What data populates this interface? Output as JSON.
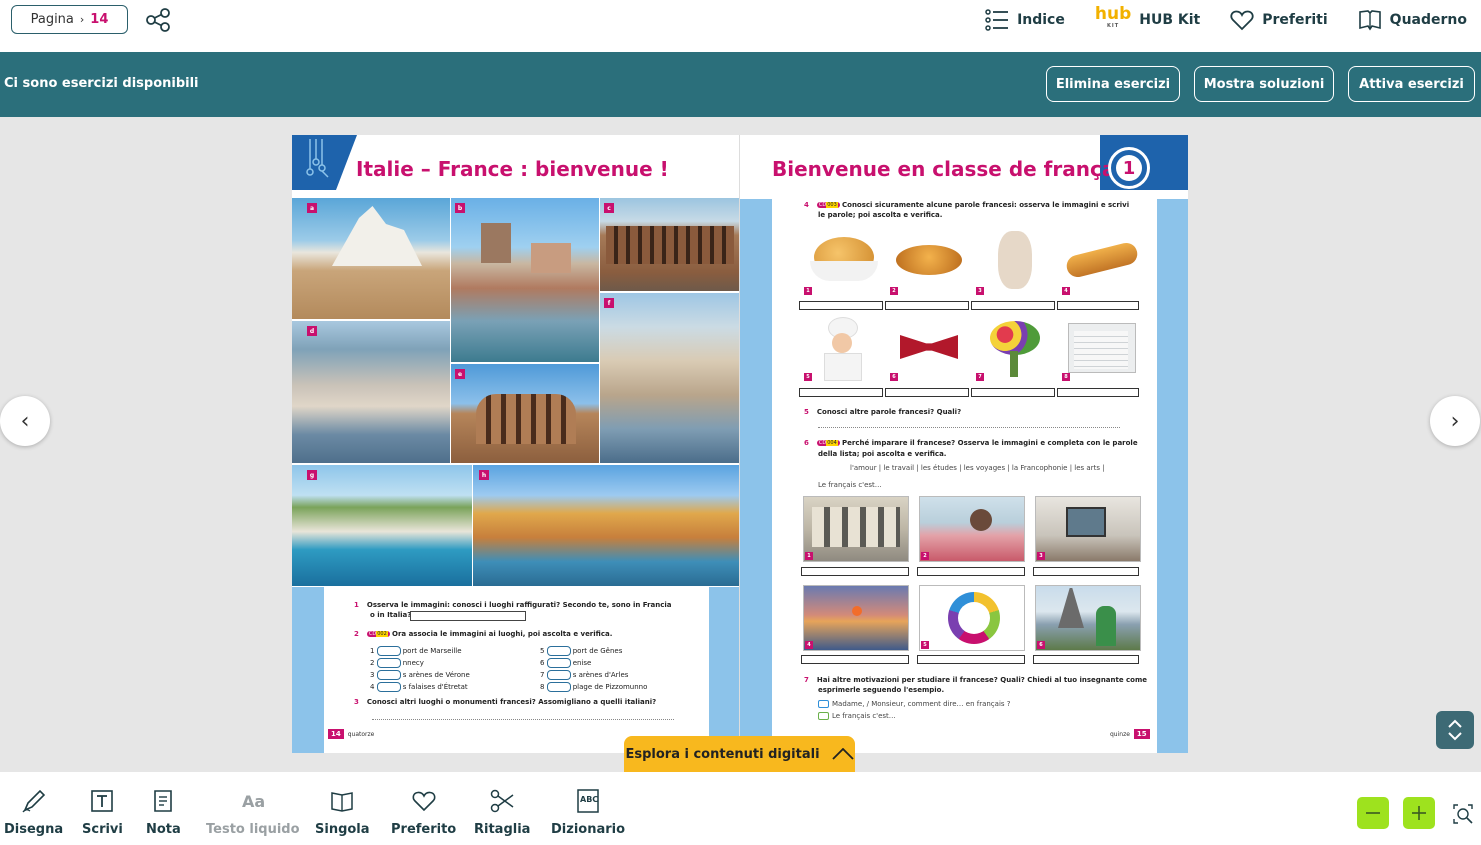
{
  "topbar": {
    "page_label": "Pagina",
    "page_number": "14",
    "nav": [
      {
        "label": "Indice",
        "icon": "list-icon"
      },
      {
        "label": "HUB Kit",
        "icon": "hub-kit-logo",
        "logo_text": "hub",
        "logo_sub": "KIT"
      },
      {
        "label": "Preferiti",
        "icon": "heart-icon"
      },
      {
        "label": "Quaderno",
        "icon": "book-icon"
      }
    ]
  },
  "exercise_bar": {
    "message": "Ci sono esercizi disponibili",
    "buttons": [
      "Elimina esercizi",
      "Mostra soluzioni",
      "Attiva esercizi"
    ]
  },
  "book": {
    "left": {
      "title": "Italie – France : bienvenue !",
      "photo_labels": [
        "a",
        "b",
        "c",
        "d",
        "e",
        "f",
        "g",
        "h"
      ],
      "ex1_num": "1",
      "ex1_text": "Osserva le immagini: conosci i luoghi raffigurati? Secondo te, sono in Francia",
      "ex1_text2": "o in Italia?",
      "ex2_num": "2",
      "ex2_cd": "CD",
      "ex2_track": "002",
      "ex2_text": "Ora associa le immagini ai luoghi, poi ascolta e verifica.",
      "ex2_items_left": [
        {
          "n": "1",
          "t": "port de Marseille"
        },
        {
          "n": "2",
          "t": "nnecy"
        },
        {
          "n": "3",
          "t": "s arènes de Vérone"
        },
        {
          "n": "4",
          "t": "s falaises d'Étretat"
        }
      ],
      "ex2_items_right": [
        {
          "n": "5",
          "t": "port de Gênes"
        },
        {
          "n": "6",
          "t": "enise"
        },
        {
          "n": "7",
          "t": "s arènes d'Arles"
        },
        {
          "n": "8",
          "t": "plage de Pizzomunno"
        }
      ],
      "ex3_num": "3",
      "ex3_text": "Conosci altri luoghi o monumenti francesi? Assomigliano a quelli italiani?",
      "page_num": "14",
      "page_word": "quatorze"
    },
    "right": {
      "title": "Bienvenue en classe de français !",
      "unit": "1",
      "ex4_num": "4",
      "ex4_cd": "CD",
      "ex4_track": "003",
      "ex4_text": "Conosci sicuramente alcune parole francesi: osserva le immagini e scrivi",
      "ex4_text2": "le parole; poi ascolta e verifica.",
      "objects": [
        "1",
        "2",
        "3",
        "4",
        "5",
        "6",
        "7",
        "8"
      ],
      "ex5_num": "5",
      "ex5_text": "Conosci altre parole francesi? Quali?",
      "ex6_num": "6",
      "ex6_cd": "CD",
      "ex6_track": "004",
      "ex6_text": "Perché imparare il francese? Osserva le immagini e completa con le parole",
      "ex6_text2": "della lista; poi ascolta e verifica.",
      "ex6_words": "l'amour | le travail | les études | les voyages | la Francophonie | les arts |",
      "ex6_prompt": "Le français c'est…",
      "photos": [
        "1",
        "2",
        "3",
        "4",
        "5",
        "6"
      ],
      "ex7_num": "7",
      "ex7_text": "Hai altre motivazioni per studiare il francese? Quali? Chiedi al tuo insegnante come",
      "ex7_text2": "esprimerle seguendo l'esempio.",
      "ex7_bubble1": "Madame, / Monsieur, comment dire… en français ?",
      "ex7_bubble2": "Le français c'est…",
      "page_num": "15",
      "page_word": "quinze"
    }
  },
  "explore_label": "Esplora i contenuti digitali",
  "toolbar": [
    {
      "label": "Disegna",
      "icon": "pen-icon",
      "enabled": true
    },
    {
      "label": "Scrivi",
      "icon": "text-box-icon",
      "enabled": true
    },
    {
      "label": "Nota",
      "icon": "note-icon",
      "enabled": true
    },
    {
      "label": "Testo liquido",
      "icon": "font-aa-icon",
      "enabled": false
    },
    {
      "label": "Singola",
      "icon": "single-page-icon",
      "enabled": true
    },
    {
      "label": "Preferito",
      "icon": "heart-icon",
      "enabled": true
    },
    {
      "label": "Ritaglia",
      "icon": "scissors-icon",
      "enabled": true
    },
    {
      "label": "Dizionario",
      "icon": "dictionary-icon",
      "enabled": true
    }
  ],
  "colors": {
    "teal": "#2b6f7b",
    "magenta": "#c8106e",
    "accent_yellow": "#f8b81e",
    "zoom_green": "#9ee21e"
  }
}
